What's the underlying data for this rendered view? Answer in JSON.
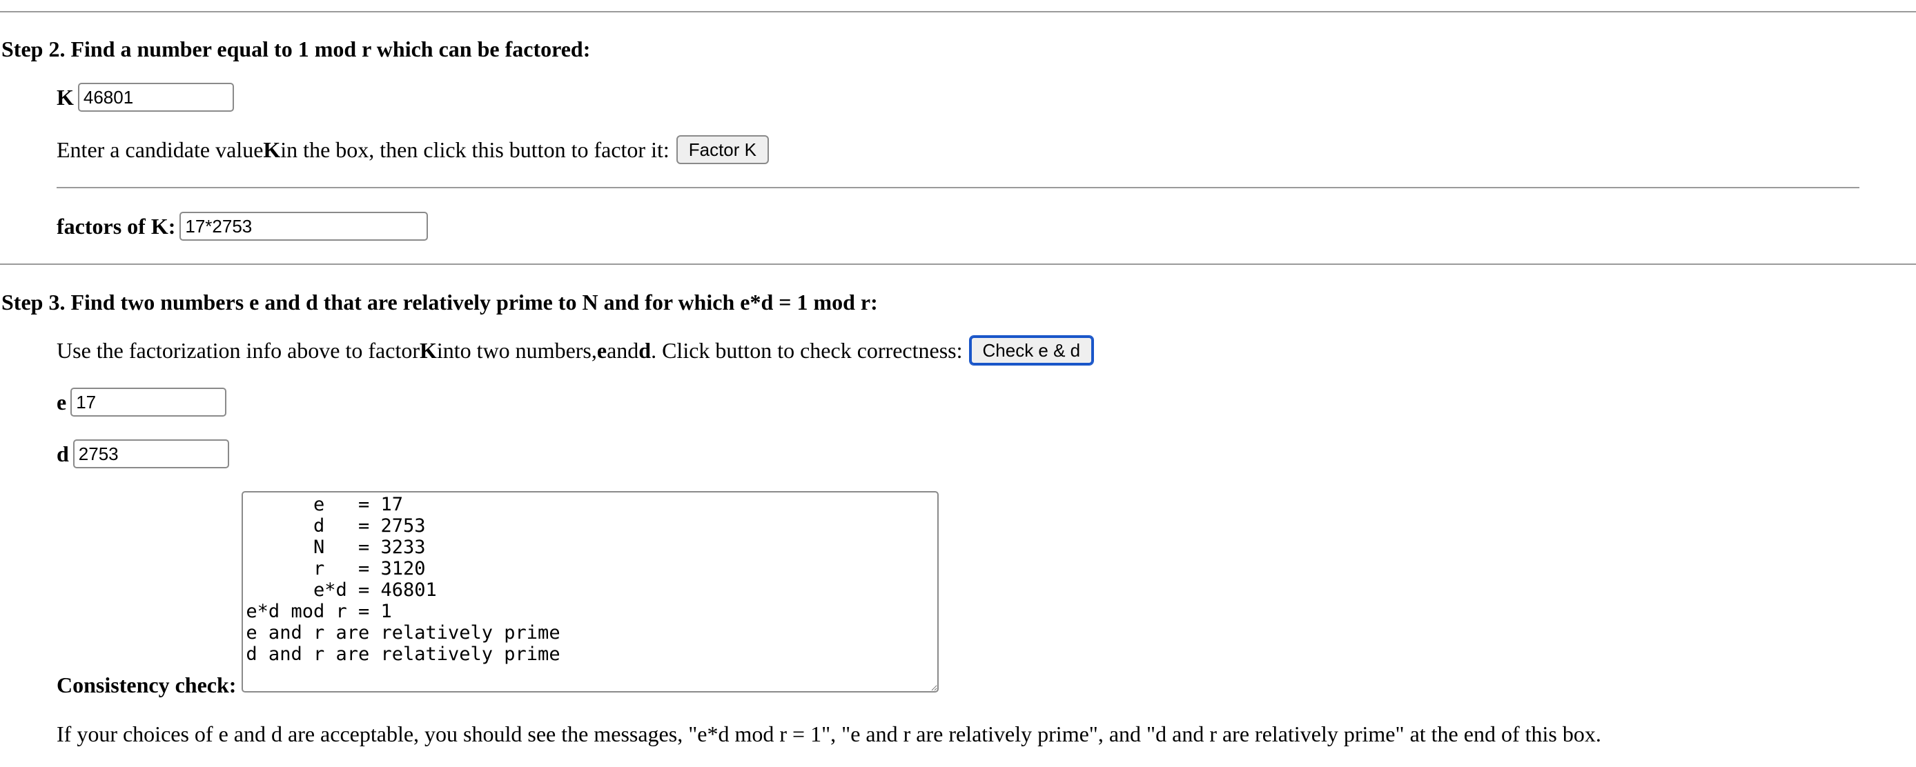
{
  "step2": {
    "heading": "Step 2. Find a number equal to 1 mod r which can be factored:",
    "k_label": "K",
    "k_value": "46801",
    "instruction_prefix": "Enter a candidate value ",
    "instruction_bold": "K",
    "instruction_suffix": " in the box, then click this button to factor it:",
    "factor_button": "Factor K",
    "factors_label": "factors of K:",
    "factors_value": "17*2753"
  },
  "step3": {
    "heading": "Step 3. Find two numbers e and d that are relatively prime to N and for which e*d = 1 mod r:",
    "instruction_part1": "Use the factorization info above to factor ",
    "instruction_bold_k": "K",
    "instruction_part2": " into two numbers, ",
    "instruction_bold_e": "e",
    "instruction_part3": " and ",
    "instruction_bold_d": "d",
    "instruction_part4": ". Click button to check correctness:",
    "check_button": "Check e & d",
    "e_label": "e",
    "e_value": "17",
    "d_label": "d",
    "d_value": "2753",
    "consistency_label": "Consistency check:",
    "consistency_output": "      e   = 17\n      d   = 2753\n      N   = 3233\n      r   = 3120\n      e*d = 46801\ne*d mod r = 1\ne and r are relatively prime\nd and r are relatively prime",
    "footer_note": "If your choices of e and d are acceptable, you should see the messages, \"e*d mod r = 1\", \"e and r are relatively prime\", and \"d and r are relatively prime\" at the end of this box."
  }
}
